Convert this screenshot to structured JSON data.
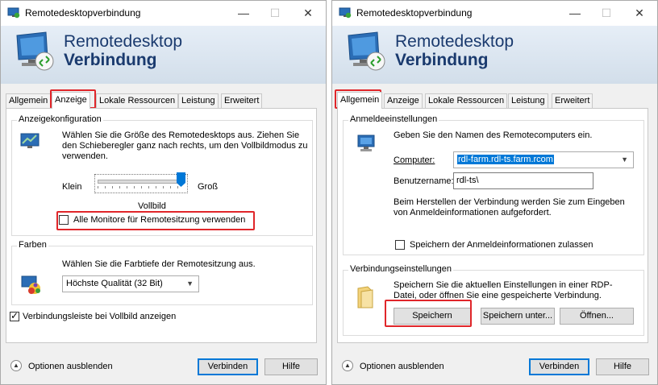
{
  "left_window": {
    "title": "Remotedesktopverbindung",
    "controls": {
      "minimize": "—",
      "maximize": "☐",
      "close": "✕"
    },
    "banner": {
      "line1": "Remotedesktop",
      "line2": "Verbindung"
    },
    "tabs": [
      "Allgemein",
      "Anzeige",
      "Lokale Ressourcen",
      "Leistung",
      "Erweitert"
    ],
    "selected_tab": "Anzeige",
    "display_group": {
      "label": "Anzeigekonfiguration",
      "description": "Wählen Sie die Größe des Remotedesktops aus. Ziehen Sie den Schieberegler ganz nach rechts, um den Vollbildmodus zu verwenden.",
      "slider_min_label": "Klein",
      "slider_max_label": "Groß",
      "slider_value_label": "Vollbild",
      "slider_level": 1.0,
      "multimon_label": "Alle Monitore für Remotesitzung verwenden",
      "multimon_checked": false
    },
    "colors_group": {
      "label": "Farben",
      "description": "Wählen Sie die Farbtiefe der Remotesitzung aus.",
      "selected_value": "Höchste Qualität (32 Bit)"
    },
    "connection_bar_label": "Verbindungsleiste bei Vollbild anzeigen",
    "connection_bar_checked": true,
    "bottom": {
      "options_label": "Optionen ausblenden",
      "connect": "Verbinden",
      "help": "Hilfe"
    }
  },
  "right_window": {
    "title": "Remotedesktopverbindung",
    "controls": {
      "minimize": "—",
      "maximize": "☐",
      "close": "✕"
    },
    "banner": {
      "line1": "Remotedesktop",
      "line2": "Verbindung"
    },
    "tabs": [
      "Allgemein",
      "Anzeige",
      "Lokale Ressourcen",
      "Leistung",
      "Erweitert"
    ],
    "selected_tab": "Allgemein",
    "logon_group": {
      "label": "Anmeldeeinstellungen",
      "description": "Geben Sie den Namen des Remotecomputers ein.",
      "computer_label": "Computer:",
      "computer_value": "rdl-farm.rdl-ts.farm.rcom",
      "username_label": "Benutzername:",
      "username_value": "rdl-ts\\",
      "info": "Beim Herstellen der Verbindung werden Sie zum Eingeben von Anmeldeinformationen aufgefordert.",
      "save_creds_label": "Speichern der Anmeldeinformationen zulassen",
      "save_creds_checked": false
    },
    "connection_group": {
      "label": "Verbindungseinstellungen",
      "description": "Speichern Sie die aktuellen Einstellungen in einer RDP-Datei, oder öffnen Sie eine gespeicherte Verbindung.",
      "save": "Speichern",
      "save_as": "Speichern unter...",
      "open": "Öffnen..."
    },
    "bottom": {
      "options_label": "Optionen ausblenden",
      "connect": "Verbinden",
      "help": "Hilfe"
    }
  },
  "colors": {
    "accent": "#0078d7",
    "highlight_box": "#e0262a",
    "banner_text": "#1a3a6e"
  }
}
